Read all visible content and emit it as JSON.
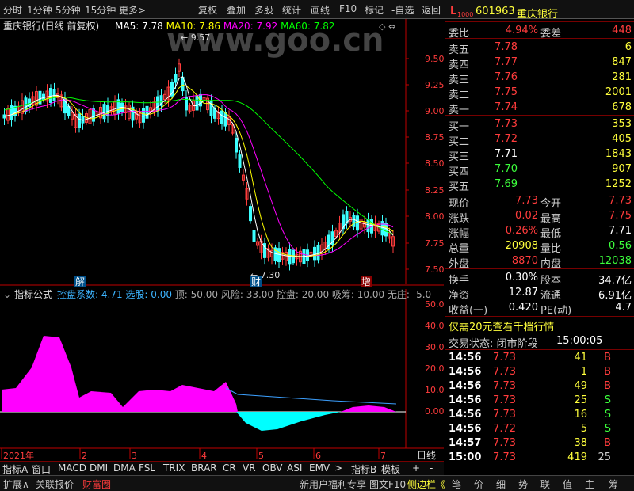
{
  "toolbar": {
    "left": [
      "分时",
      "1分钟",
      "5分钟",
      "15分钟",
      "更多>"
    ],
    "right": [
      "复权",
      "叠加",
      "多股",
      "统计",
      "画线",
      "F10",
      "标记",
      "-自选",
      "返回"
    ]
  },
  "chart": {
    "title": "重庆银行(日线 前复权)",
    "ma_labels": [
      {
        "text": "MA5: 7.78",
        "color": "#ffffff"
      },
      {
        "text": "MA10: 7.86",
        "color": "#ffff00"
      },
      {
        "text": "MA20: 7.92",
        "color": "#ff00ff"
      },
      {
        "text": "MA60: 7.82",
        "color": "#00ff00"
      }
    ],
    "price_ticks": [
      "9.50",
      "9.25",
      "9.00",
      "8.75",
      "8.50",
      "8.25",
      "8.00",
      "7.75",
      "7.50"
    ],
    "high_label": "9.57",
    "low_label": "7.30",
    "event_markers": [
      "解",
      "财",
      "增"
    ],
    "watermark": "www.goo.cn"
  },
  "indicator": {
    "name": "指标公式",
    "items": [
      {
        "text": "控盘系数: 4.71",
        "color": "#3cb4ff"
      },
      {
        "text": "选股: 0.00",
        "color": "#3cb4ff"
      },
      {
        "text": "顶: 50.00",
        "color": "#aaaaaa"
      },
      {
        "text": "风险: 33.00",
        "color": "#aaaaaa"
      },
      {
        "text": "控盘: 20.00",
        "color": "#aaaaaa"
      },
      {
        "text": "吸筹: 10.00",
        "color": "#aaaaaa"
      },
      {
        "text": "无庄: -5.0",
        "color": "#aaaaaa"
      }
    ],
    "ticks": [
      "50.00",
      "40.00",
      "30.00",
      "20.00",
      "10.00",
      "0.00",
      "-10.00"
    ]
  },
  "time_axis": {
    "labels": [
      "2021年",
      "2",
      "3",
      "4",
      "5",
      "6",
      "7"
    ],
    "right": "日线"
  },
  "bottom_tabs": [
    "指标A",
    "窗口",
    "MACD",
    "DMI",
    "DMA",
    "FSL",
    "TRIX",
    "BRAR",
    "CR",
    "VR",
    "OBV",
    "ASI",
    "EMV",
    ">",
    "指标B",
    "模板",
    "+",
    "-"
  ],
  "statusbar": {
    "left": [
      {
        "text": "扩展∧",
        "color": "#ccc"
      },
      {
        "text": "关联报价",
        "color": "#ccc"
      },
      {
        "text": "财富圈",
        "color": "#ff3c3c"
      }
    ],
    "right": [
      {
        "text": "新用户福利专享",
        "color": "#ccc"
      },
      {
        "text": "图文F10",
        "color": "#ccc"
      },
      {
        "text": "侧边栏《",
        "color": "#ffff3c"
      },
      {
        "text": "笔",
        "color": "#ccc"
      },
      {
        "text": "价",
        "color": "#ccc"
      },
      {
        "text": "细",
        "color": "#ccc"
      },
      {
        "text": "势",
        "color": "#ccc"
      },
      {
        "text": "联",
        "color": "#ccc"
      },
      {
        "text": "值",
        "color": "#ccc"
      },
      {
        "text": "主",
        "color": "#ccc"
      },
      {
        "text": "筹",
        "color": "#ccc"
      }
    ]
  },
  "stock": {
    "badge": "L",
    "badge_sub": "1000",
    "code": "601963",
    "name": "重庆银行"
  },
  "weibi": {
    "label1": "委比",
    "val1": "4.94%",
    "label2": "委差",
    "val2": "448"
  },
  "asks": [
    {
      "label": "卖五",
      "price": "7.78",
      "vol": "6"
    },
    {
      "label": "卖四",
      "price": "7.77",
      "vol": "847"
    },
    {
      "label": "卖三",
      "price": "7.76",
      "vol": "281"
    },
    {
      "label": "卖二",
      "price": "7.75",
      "vol": "2001"
    },
    {
      "label": "卖一",
      "price": "7.74",
      "vol": "678"
    }
  ],
  "bids": [
    {
      "label": "买一",
      "price": "7.73",
      "vol": "353",
      "pc": "up"
    },
    {
      "label": "买二",
      "price": "7.72",
      "vol": "405",
      "pc": "up"
    },
    {
      "label": "买三",
      "price": "7.71",
      "vol": "1843",
      "pc": "wh"
    },
    {
      "label": "买四",
      "price": "7.70",
      "vol": "907",
      "pc": "dn"
    },
    {
      "label": "买五",
      "price": "7.69",
      "vol": "1252",
      "pc": "dn"
    }
  ],
  "quote": [
    {
      "l1": "现价",
      "v1": "7.73",
      "c1": "up",
      "l2": "今开",
      "v2": "7.73",
      "c2": "up"
    },
    {
      "l1": "涨跌",
      "v1": "0.02",
      "c1": "up",
      "l2": "最高",
      "v2": "7.75",
      "c2": "up"
    },
    {
      "l1": "涨幅",
      "v1": "0.26%",
      "c1": "up",
      "l2": "最低",
      "v2": "7.71",
      "c2": "wh"
    },
    {
      "l1": "总量",
      "v1": "20908",
      "c1": "yl",
      "l2": "量比",
      "v2": "0.56",
      "c2": "dn"
    },
    {
      "l1": "外盘",
      "v1": "8870",
      "c1": "up",
      "l2": "内盘",
      "v2": "12038",
      "c2": "dn"
    }
  ],
  "fundamentals": [
    {
      "l1": "换手",
      "v1": "0.30%",
      "l2": "股本",
      "v2": "34.7亿"
    },
    {
      "l1": "净资",
      "v1": "12.87",
      "l2": "流通",
      "v2": "6.91亿"
    },
    {
      "l1": "收益(一)",
      "v1": "0.420",
      "l2": "PE(动)",
      "v2": "4.7"
    }
  ],
  "promo": "仅需20元查看千档行情",
  "trade_state": {
    "label": "交易状态: 闭市阶段",
    "time": "15:00:05"
  },
  "ticks": [
    {
      "time": "14:56",
      "price": "7.73",
      "pc": "up",
      "vol": "41",
      "side": "B"
    },
    {
      "time": "14:56",
      "price": "7.73",
      "pc": "up",
      "vol": "1",
      "side": "B"
    },
    {
      "time": "14:56",
      "price": "7.73",
      "pc": "up",
      "vol": "49",
      "side": "B"
    },
    {
      "time": "14:56",
      "price": "7.73",
      "pc": "up",
      "vol": "25",
      "side": "S"
    },
    {
      "time": "14:56",
      "price": "7.73",
      "pc": "up",
      "vol": "16",
      "side": "S"
    },
    {
      "time": "14:56",
      "price": "7.72",
      "pc": "up",
      "vol": "5",
      "side": "S"
    },
    {
      "time": "14:57",
      "price": "7.73",
      "pc": "up",
      "vol": "38",
      "side": "B"
    },
    {
      "time": "15:00",
      "price": "7.73",
      "pc": "up",
      "vol": "419",
      "side": "25"
    }
  ],
  "colors": {
    "up": "#ff3c3c",
    "down": "#3cff3c",
    "axis": "#c00000",
    "ma5": "#ffffff",
    "ma10": "#ffff00",
    "ma20": "#ff00ff",
    "ma60": "#00ff00"
  }
}
